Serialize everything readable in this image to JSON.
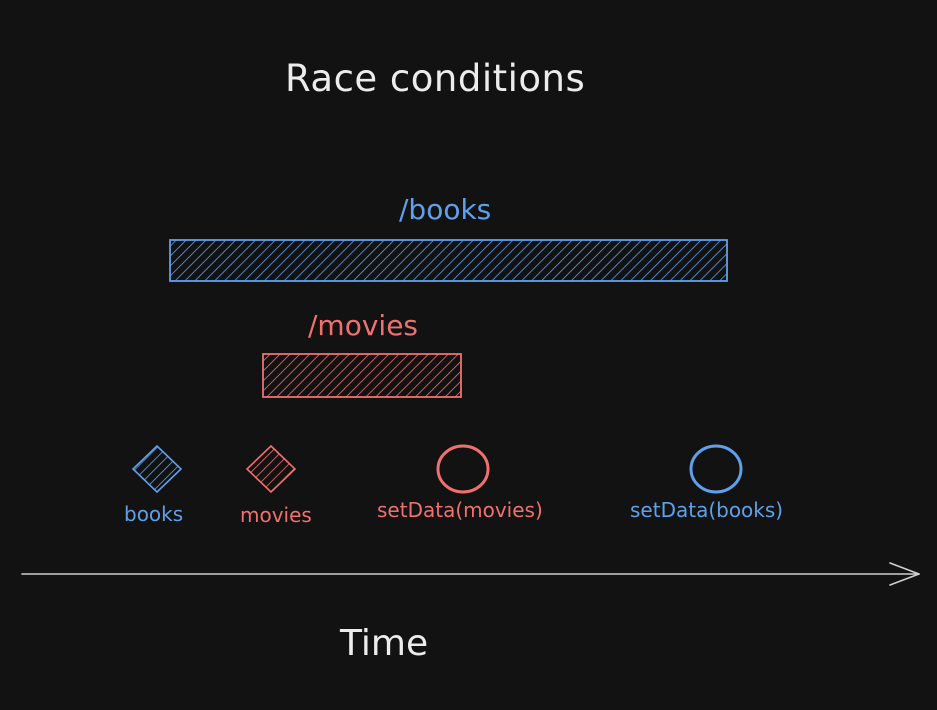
{
  "title": "Race conditions",
  "colors": {
    "background": "#121212",
    "books": "#5fa0ea",
    "movies": "#f07070",
    "text": "#ececec",
    "axis": "#cfcfcf"
  },
  "requests": [
    {
      "label": "/books",
      "series": "books"
    },
    {
      "label": "/movies",
      "series": "movies"
    }
  ],
  "legend": [
    {
      "label": "books",
      "icon": "hatched-diamond-icon"
    },
    {
      "label": "movies",
      "icon": "hatched-diamond-icon"
    }
  ],
  "events": [
    {
      "label": "setData(movies)",
      "icon": "circle-icon"
    },
    {
      "label": "setData(books)",
      "icon": "circle-icon"
    }
  ],
  "axis": {
    "label": "Time",
    "icon": "arrow-right-icon"
  }
}
